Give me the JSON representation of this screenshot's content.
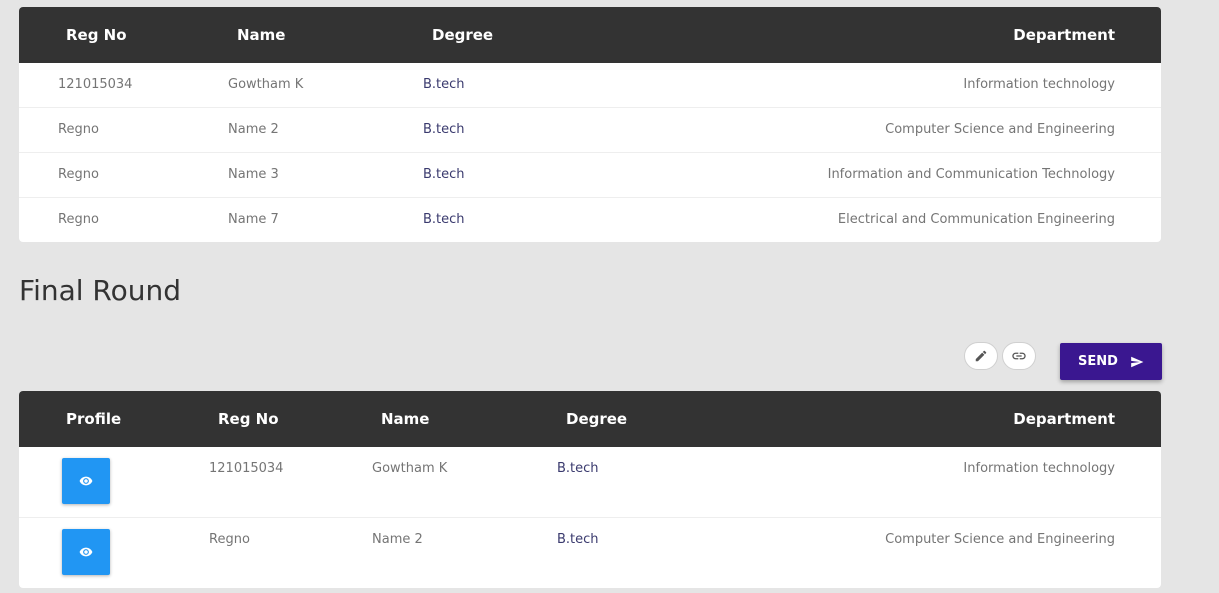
{
  "table1": {
    "headers": {
      "regno": "Reg No",
      "name": "Name",
      "degree": "Degree",
      "department": "Department"
    },
    "rows": [
      {
        "regno": "121015034",
        "name": "Gowtham K",
        "degree": "B.tech",
        "department": "Information technology"
      },
      {
        "regno": "Regno",
        "name": "Name 2",
        "degree": "B.tech",
        "department": "Computer Science and Engineering"
      },
      {
        "regno": "Regno",
        "name": "Name 3",
        "degree": "B.tech",
        "department": "Information and Communication Technology"
      },
      {
        "regno": "Regno",
        "name": "Name 7",
        "degree": "B.tech",
        "department": "Electrical and Communication Engineering"
      }
    ]
  },
  "final_round": {
    "title": "Final Round",
    "toolbar": {
      "edit_icon": "pencil-icon",
      "link_icon": "link-icon",
      "send_label": "SEND",
      "send_icon": "send-icon"
    },
    "headers": {
      "profile": "Profile",
      "regno": "Reg No",
      "name": "Name",
      "degree": "Degree",
      "department": "Department"
    },
    "rows": [
      {
        "regno": "121015034",
        "name": "Gowtham K",
        "degree": "B.tech",
        "department": "Information technology",
        "profile_icon": "eye-icon"
      },
      {
        "regno": "Regno",
        "name": "Name 2",
        "degree": "B.tech",
        "department": "Computer Science and Engineering",
        "profile_icon": "eye-icon"
      }
    ]
  },
  "colors": {
    "header_bg": "#333333",
    "send_bg": "#3a1790",
    "profile_button": "#2196f3",
    "page_bg": "#e5e5e5"
  }
}
